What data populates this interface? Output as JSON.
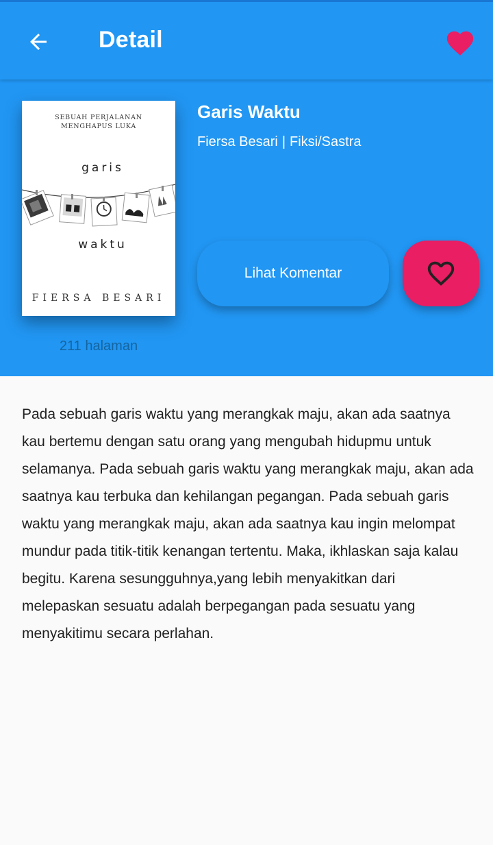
{
  "appbar": {
    "title": "Detail",
    "back_icon": "arrow-back-icon",
    "favorite_icon": "heart-filled-icon"
  },
  "book": {
    "title": "Garis Waktu",
    "author": "Fiersa Besari",
    "separator": "|",
    "genre": "Fiksi/Sastra",
    "pages_label": "211 halaman",
    "cover": {
      "subtitle_line1": "SEBUAH PERJALANAN",
      "subtitle_line2": "MENGHAPUS LUKA",
      "title_line1": "garis",
      "title_line2": "waktu",
      "author": "FIERSA BESARI"
    }
  },
  "actions": {
    "comment_label": "Lihat Komentar",
    "favorite_icon": "heart-outline-icon"
  },
  "description": "Pada sebuah garis waktu yang merangkak maju, akan ada saatnya kau bertemu dengan satu orang yang mengubah hidupmu untuk selamanya. Pada sebuah garis waktu yang merangkak maju, akan ada saatnya kau terbuka dan kehilangan pegangan. Pada sebuah garis waktu yang merangkak maju, akan ada saatnya kau ingin melompat mundur pada titik-titik kenangan tertentu. Maka, ikhlaskan saja kalau begitu. Karena sesungguhnya,yang lebih menyakitkan dari melepaskan sesuatu adalah berpegangan pada sesuatu yang menyakitimu secara perlahan.",
  "colors": {
    "primary": "#2196f3",
    "accent": "#e91e63",
    "background": "#fafafa"
  }
}
